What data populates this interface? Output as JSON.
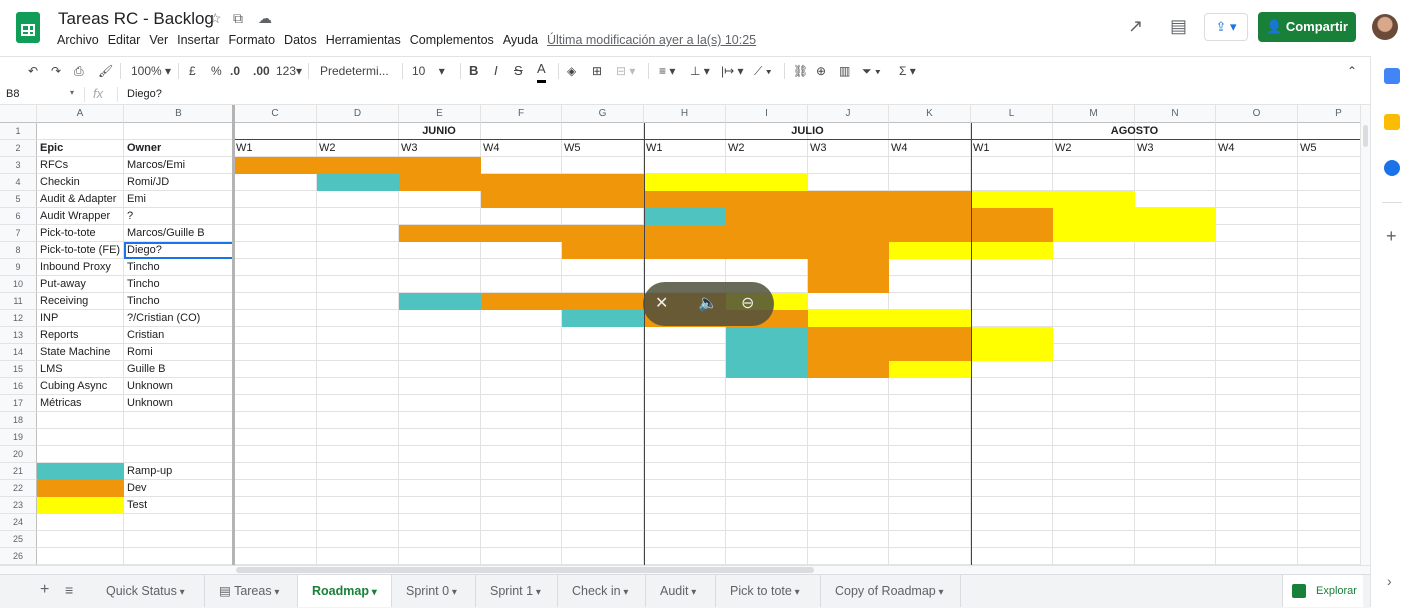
{
  "header": {
    "title": "Tareas RC - Backlog",
    "menu": [
      "Archivo",
      "Editar",
      "Ver",
      "Insertar",
      "Formato",
      "Datos",
      "Herramientas",
      "Complementos",
      "Ayuda"
    ],
    "last_edit": "Última modificación ayer a la(s) 10:25",
    "share_label": "Compartir"
  },
  "toolbar": {
    "zoom": "100%",
    "currency": "£",
    "percent": "%",
    "dec_less": ".0",
    "dec_more": ".00",
    "format_more": "123",
    "font": "Predetermi...",
    "font_size": "10",
    "bold": "B",
    "italic": "I",
    "strike": "S",
    "text_color": "A",
    "functions": "Σ"
  },
  "formula_bar": {
    "cell_ref": "B8",
    "fx": "fx",
    "content": "Diego?"
  },
  "grid": {
    "column_letters": [
      "A",
      "B",
      "C",
      "D",
      "E",
      "F",
      "G",
      "H",
      "I",
      "J",
      "K",
      "L",
      "M",
      "N",
      "O",
      "P"
    ],
    "row_numbers": [
      "1",
      "2",
      "3",
      "4",
      "5",
      "6",
      "7",
      "8",
      "9",
      "10",
      "11",
      "12",
      "13",
      "14",
      "15",
      "16",
      "17",
      "18",
      "19",
      "20",
      "21",
      "22",
      "23",
      "24",
      "25",
      "26"
    ],
    "months": [
      "JUNIO",
      "JULIO",
      "AGOSTO"
    ],
    "weeks": [
      "W1",
      "W2",
      "W3",
      "W4",
      "W5",
      "W1",
      "W2",
      "W3",
      "W4",
      "W1",
      "W2",
      "W3",
      "W4",
      "W5"
    ],
    "headers": {
      "epic": "Epic",
      "owner": "Owner"
    },
    "tasks": [
      {
        "epic": "RFCs",
        "owner": "Marcos/Emi"
      },
      {
        "epic": "Checkin",
        "owner": "Romi/JD"
      },
      {
        "epic": "Audit & Adapter",
        "owner": "Emi"
      },
      {
        "epic": "Audit Wrapper",
        "owner": "?"
      },
      {
        "epic": "Pick-to-tote",
        "owner": "Marcos/Guille B"
      },
      {
        "epic": "Pick-to-tote (FE)",
        "owner": "Diego?"
      },
      {
        "epic": "Inbound Proxy",
        "owner": "Tincho"
      },
      {
        "epic": "Put-away",
        "owner": "Tincho"
      },
      {
        "epic": "Receiving",
        "owner": "Tincho"
      },
      {
        "epic": "INP",
        "owner": "?/Cristian (CO)"
      },
      {
        "epic": "Reports",
        "owner": "Cristian"
      },
      {
        "epic": "State Machine",
        "owner": "Romi"
      },
      {
        "epic": "LMS",
        "owner": "Guille B"
      },
      {
        "epic": "Cubing Async",
        "owner": "Unknown"
      },
      {
        "epic": "Métricas",
        "owner": "Unknown"
      }
    ],
    "legend": [
      {
        "label": "Ramp-up",
        "color": "#4fc3c0"
      },
      {
        "label": "Dev",
        "color": "#f0960a"
      },
      {
        "label": "Test",
        "color": "#ffff00"
      }
    ],
    "gantt": [
      {
        "row": 3,
        "segments": [
          [
            "dev",
            0,
            3
          ]
        ]
      },
      {
        "row": 4,
        "segments": [
          [
            "ramp",
            1,
            1
          ],
          [
            "dev",
            2,
            3
          ],
          [
            "test",
            5,
            2
          ]
        ]
      },
      {
        "row": 5,
        "segments": [
          [
            "dev",
            3,
            6
          ],
          [
            "test",
            9,
            2
          ]
        ]
      },
      {
        "row": 6,
        "segments": [
          [
            "ramp",
            5,
            1
          ],
          [
            "dev",
            6,
            4
          ],
          [
            "test",
            10,
            2
          ]
        ]
      },
      {
        "row": 7,
        "segments": [
          [
            "dev",
            2,
            8
          ],
          [
            "test",
            10,
            2
          ]
        ]
      },
      {
        "row": 8,
        "segments": [
          [
            "dev",
            4,
            4
          ],
          [
            "test",
            8,
            2
          ]
        ]
      },
      {
        "row": 9,
        "segments": [
          [
            "dev",
            7,
            1
          ]
        ]
      },
      {
        "row": 10,
        "segments": [
          [
            "dev",
            7,
            1
          ]
        ]
      },
      {
        "row": 11,
        "segments": [
          [
            "ramp",
            2,
            1
          ],
          [
            "dev",
            3,
            3
          ],
          [
            "test",
            6,
            1
          ]
        ]
      },
      {
        "row": 12,
        "segments": [
          [
            "ramp",
            4,
            1
          ],
          [
            "dev",
            5,
            2
          ],
          [
            "test",
            7,
            2
          ]
        ]
      },
      {
        "row": 13,
        "segments": [
          [
            "ramp",
            6,
            1
          ],
          [
            "dev",
            7,
            2
          ],
          [
            "test",
            9,
            1
          ]
        ]
      },
      {
        "row": 14,
        "segments": [
          [
            "ramp",
            6,
            1
          ],
          [
            "dev",
            7,
            2
          ],
          [
            "test",
            9,
            1
          ]
        ]
      },
      {
        "row": 15,
        "segments": [
          [
            "ramp",
            6,
            1
          ],
          [
            "dev",
            7,
            1
          ],
          [
            "test",
            8,
            1
          ]
        ]
      }
    ]
  },
  "sheets": {
    "tabs": [
      "Quick Status",
      "Tareas",
      "Roadmap",
      "Sprint 0",
      "Sprint 1",
      "Check in",
      "Audit",
      "Pick to tote",
      "Copy of Roadmap"
    ],
    "active": "Roadmap",
    "explore_label": "Explorar"
  },
  "colors": {
    "ramp": "#4fc3c0",
    "dev": "#f0960a",
    "test": "#ffff00",
    "accent": "#188038"
  }
}
